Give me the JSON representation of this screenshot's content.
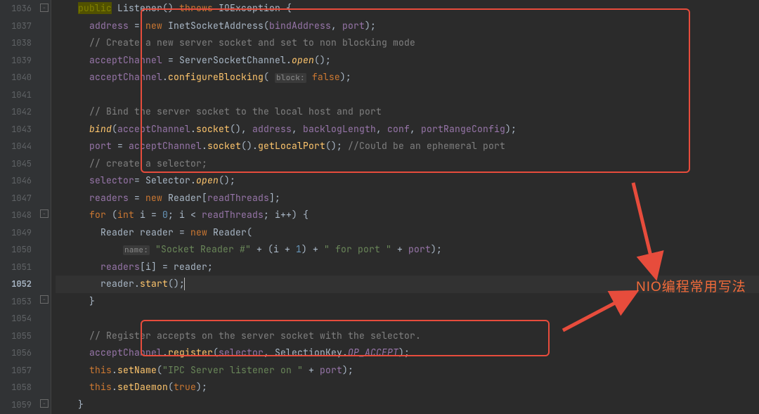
{
  "line_numbers": [
    "1036",
    "1037",
    "1038",
    "1039",
    "1040",
    "1041",
    "1042",
    "1043",
    "1044",
    "1045",
    "1046",
    "1047",
    "1048",
    "1049",
    "1050",
    "1051",
    "1052",
    "1053",
    "1054",
    "1055",
    "1056",
    "1057",
    "1058",
    "1059"
  ],
  "current_line": "1052",
  "annotation": "NIO编程常用写法",
  "code": {
    "l1036": {
      "indent": "    ",
      "kw_public": "public",
      "ident": " Listener() ",
      "kw_throws": "throws",
      "exc": " IOException {"
    },
    "l1037": {
      "indent": "      ",
      "fld": "address ",
      "op": "= ",
      "kw": "new ",
      "cls": "InetSocketAddress",
      "paren": "(",
      "arg1": "bindAddress",
      "comma": ", ",
      "arg2": "port",
      "close": ");"
    },
    "l1038": {
      "indent": "      ",
      "cmt": "// Create a new server socket and set to non blocking mode"
    },
    "l1039": {
      "indent": "      ",
      "fld": "acceptChannel ",
      "op": "= ServerSocketChannel.",
      "mth": "open",
      "close": "();"
    },
    "l1040": {
      "indent": "      ",
      "fld": "acceptChannel",
      "dot": ".",
      "mth": "configureBlocking",
      "paren": "( ",
      "param": "block:",
      "sp": " ",
      "val": "false",
      "close": ");"
    },
    "l1042": {
      "indent": "      ",
      "cmt": "// Bind the server socket to the local host and port"
    },
    "l1043": {
      "indent": "      ",
      "mth": "bind",
      "paren": "(",
      "a1": "acceptChannel",
      "dot": ".",
      "m2": "socket",
      "p2": "(), ",
      "a2": "address",
      "c2": ", ",
      "a3": "backlogLength",
      "c3": ", ",
      "a4": "conf",
      "c4": ", ",
      "a5": "portRangeConfig",
      "close": ");"
    },
    "l1044": {
      "indent": "      ",
      "fld": "port ",
      "op": "= ",
      "a1": "acceptChannel",
      "dot": ".",
      "m1": "socket",
      "p1": "().",
      "m2": "getLocalPort",
      "p2": "(); ",
      "cmt": "//Could be an ephemeral port"
    },
    "l1045": {
      "indent": "      ",
      "cmt": "// create a selector;"
    },
    "l1046": {
      "indent": "      ",
      "fld": "selector",
      "op": "= Selector.",
      "mth": "open",
      "close": "();"
    },
    "l1047": {
      "indent": "      ",
      "fld": "readers ",
      "op": "= ",
      "kw": "new ",
      "cls": "Reader[",
      "a": "readThreads",
      "close": "];"
    },
    "l1048": {
      "indent": "      ",
      "kw": "for ",
      "open": "(",
      "kw2": "int ",
      "var": "i = ",
      "num0": "0",
      "semi": "; i < ",
      "a": "readThreads",
      "semi2": "; i++) {"
    },
    "l1049": {
      "indent": "        ",
      "cls": "Reader reader = ",
      "kw": "new ",
      "cls2": "Reader("
    },
    "l1050": {
      "indent": "            ",
      "param": "name:",
      "sp": " ",
      "str": "\"Socket Reader #\"",
      "op": " + (i + ",
      "num": "1",
      "op2": ") + ",
      "str2": "\" for port \"",
      "op3": " + ",
      "fld": "port",
      "close": ");"
    },
    "l1051": {
      "indent": "        ",
      "fld": "readers",
      "br": "[i] = reader;"
    },
    "l1052": {
      "indent": "        ",
      "var": "reader.",
      "mth": "start",
      "close": "();"
    },
    "l1053": {
      "indent": "      ",
      "brace": "}"
    },
    "l1055": {
      "indent": "      ",
      "cmt": "// Register accepts on the server socket with the selector."
    },
    "l1056": {
      "indent": "      ",
      "fld": "acceptChannel",
      "dot": ".",
      "mth": "register",
      "open": "(",
      "a1": "selector",
      "c": ", SelectionKey.",
      "const": "OP_ACCEPT",
      "close": ");"
    },
    "l1057": {
      "indent": "      ",
      "kw": "this",
      "dot": ".",
      "mth": "setName",
      "open": "(",
      "str": "\"IPC Server listener on \"",
      "op": " + ",
      "fld": "port",
      "close": ");"
    },
    "l1058": {
      "indent": "      ",
      "kw": "this",
      "dot": ".",
      "mth": "setDaemon",
      "open": "(",
      "val": "true",
      "close": ");"
    },
    "l1059": {
      "indent": "    ",
      "brace": "}"
    }
  }
}
